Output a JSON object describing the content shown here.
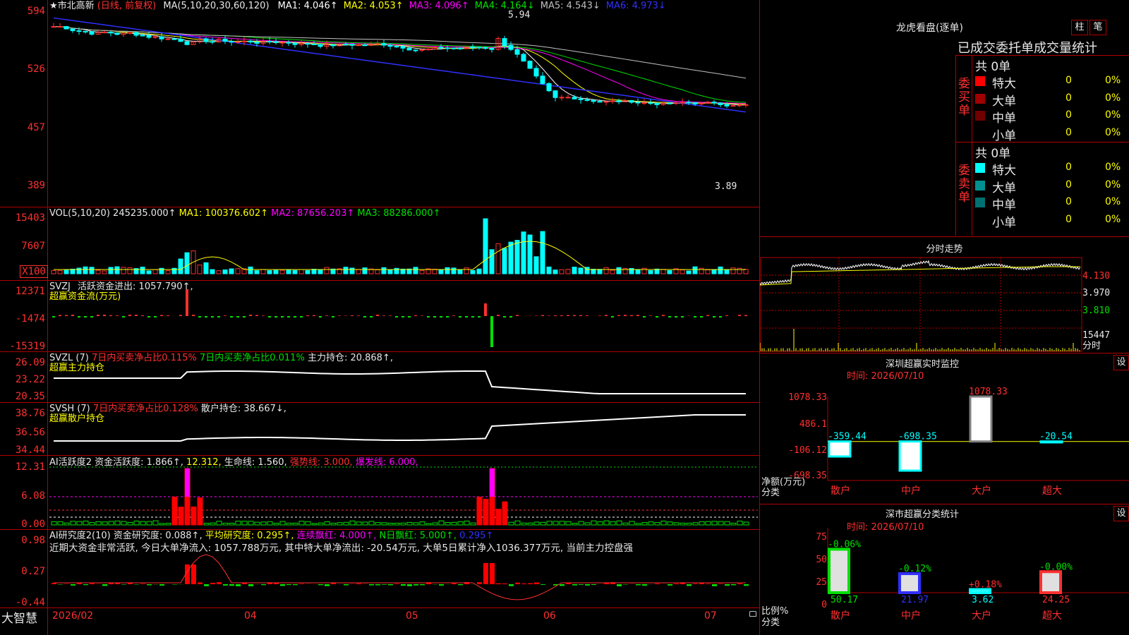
{
  "stock": {
    "title": "★市北高新",
    "mode": "(日线, 前复权)"
  },
  "price_panel": {
    "ma_header": "MA(5,10,20,30,60,120)",
    "ma_items": [
      {
        "label": "MA1:",
        "value": "4.046↑",
        "color": "#ffffff"
      },
      {
        "label": "MA2:",
        "value": "4.053↑",
        "color": "#ffff00"
      },
      {
        "label": "MA3:",
        "value": "4.096↑",
        "color": "#ff00ff"
      },
      {
        "label": "MA4:",
        "value": "4.164↓",
        "color": "#00e000"
      },
      {
        "label": "MA5:",
        "value": "4.543↓",
        "color": "#c0c0c0"
      },
      {
        "label": "MA6:",
        "value": "4.973↓",
        "color": "#3030ff"
      }
    ],
    "y_ticks": [
      "594",
      "526",
      "457",
      "389"
    ],
    "high_mark": "5.94",
    "low_mark": "3.89"
  },
  "vol_panel": {
    "header": "VOL(5,10,20)",
    "value": "245235.000↑",
    "ma1": "MA1: 100376.602↑",
    "ma2": "MA2: 87656.203↑",
    "ma3": "MA3: 88286.000↑",
    "y_ticks": [
      "15403",
      "7607",
      "X100"
    ]
  },
  "svzj_panel": {
    "header": "SVZJ",
    "line1": "活跃资金进出: 1057.790↑,",
    "line2": "超赢资金流(万元)",
    "y_ticks": [
      "12371",
      "-1474",
      "-15319"
    ]
  },
  "svzl_panel": {
    "header": "SVZL (7)",
    "item1": "7日内买卖净占比0.115%",
    "item2": "7日内买卖净占比0.011%",
    "item3": "主力持仓: 20.868↑,",
    "line2": "超赢主力持仓",
    "y_ticks": [
      "26.09",
      "23.22",
      "20.35"
    ]
  },
  "svsh_panel": {
    "header": "SVSH (7)",
    "item1": "7日内买卖净占比0.128%",
    "item2": "散户持仓: 38.667↓,",
    "line2": "超赢散户持仓",
    "y_ticks": [
      "38.76",
      "36.56",
      "34.44"
    ]
  },
  "ai_active_panel": {
    "header": "AI活跃度2",
    "item1": "资金活跃度: 1.866↑,",
    "item2": "12.312,",
    "item3": "生命线: 1.560,",
    "item4": "强势线: 3.000,",
    "item5": "爆发线: 6.000,",
    "y_ticks": [
      "12.31",
      "6.08",
      "0.00"
    ]
  },
  "ai_research_panel": {
    "header": "AI研究度2(10)",
    "item1": "资金研究度: 0.088↑,",
    "item2": "平均研究度: 0.295↑,",
    "item3": "连续飘红: 4.000↑,",
    "item4": "N日飘红: 5.000↑,",
    "item5": "0.295↑",
    "comment": "近期大资金非常活跃, 今日大单净流入: 1057.788万元, 其中特大单净流出: -20.54万元, 大单5日累计净入1036.377万元, 当前主力控盘强",
    "y_ticks": [
      "0.98",
      "0.27",
      "-0.44"
    ]
  },
  "x_axis": {
    "brand": "大智慧",
    "labels": [
      "2026/02",
      "04",
      "05",
      "06",
      "07"
    ]
  },
  "lhb": {
    "title": "龙虎看盘(逐单)",
    "btn_bar": "柱",
    "btn_pen": "笔",
    "subtitle": "已成交委托单成交量统计",
    "buy_label": "委买单",
    "buy_total": "共 0单",
    "sell_label": "委卖单",
    "sell_total": "共 0单",
    "buy_rows": [
      {
        "name": "特大",
        "count": "0",
        "pct": "0%",
        "color": "#ff0000"
      },
      {
        "name": "大单",
        "count": "0",
        "pct": "0%",
        "color": "#a00000"
      },
      {
        "name": "中单",
        "count": "0",
        "pct": "0%",
        "color": "#700000"
      },
      {
        "name": "小单",
        "count": "0",
        "pct": "0%",
        "color": "#000000"
      }
    ],
    "sell_rows": [
      {
        "name": "特大",
        "count": "0",
        "pct": "0%",
        "color": "#00ffff"
      },
      {
        "name": "大单",
        "count": "0",
        "pct": "0%",
        "color": "#009090"
      },
      {
        "name": "中单",
        "count": "0",
        "pct": "0%",
        "color": "#007070"
      },
      {
        "name": "小单",
        "count": "0",
        "pct": "0%",
        "color": "#000000"
      }
    ]
  },
  "intraday": {
    "title": "分时走势",
    "y_ticks": [
      "4.130",
      "3.970",
      "3.810"
    ],
    "vol_tick": "15447",
    "vol_unit": "分时"
  },
  "realtime": {
    "title": "深圳超赢实时监控",
    "settings": "设",
    "time": "时间: 2026/07/10",
    "y_ticks": [
      "1078.33",
      "486.1",
      "-106.12",
      "-698.35"
    ],
    "y_name1": "净额(万元)",
    "y_name2": "分类",
    "chart_data": {
      "type": "bar",
      "categories": [
        "散户",
        "中户",
        "大户",
        "超大"
      ],
      "values": [
        -359.44,
        -698.35,
        1078.33,
        -20.54
      ],
      "labels": [
        "-359.44",
        "-698.35",
        "1078.33",
        "-20.54"
      ],
      "ylim": [
        -698.35,
        1078.33
      ]
    }
  },
  "classify": {
    "title": "深市超赢分类统计",
    "settings": "设",
    "time": "时间: 2026/07/10",
    "y_ticks": [
      "75",
      "50",
      "25",
      "0"
    ],
    "y_name1": "比例%",
    "y_name2": "分类",
    "chart_data": {
      "type": "bar",
      "categories": [
        "散户",
        "中户",
        "大户",
        "超大"
      ],
      "values": [
        50.17,
        21.97,
        3.62,
        24.25
      ],
      "value_labels": [
        "50.17",
        "21.97",
        "3.62",
        "24.25"
      ],
      "change_labels": [
        "-0.06%",
        "-0.12%",
        "+0.18%",
        "-0.00%"
      ],
      "ylim": [
        0,
        75
      ]
    }
  }
}
